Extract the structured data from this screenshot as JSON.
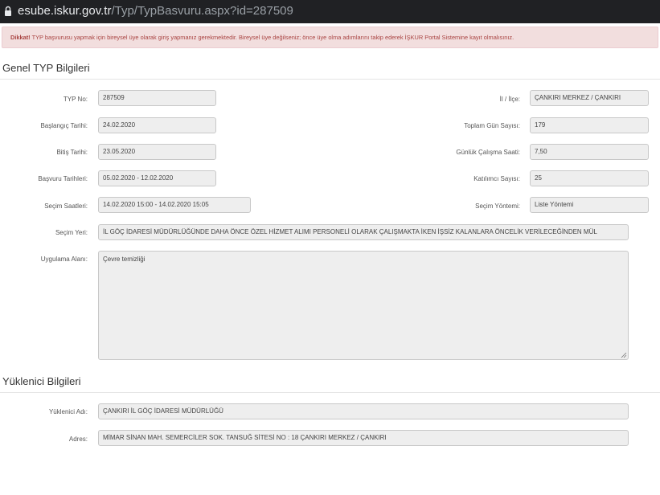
{
  "browser": {
    "url_host": "esube.iskur.gov.tr",
    "url_path": "/Typ/TypBasvuru.aspx?id=287509"
  },
  "alert": {
    "prefix": "Dikkat!",
    "text": " TYP başvurusu yapmak için bireysel üye olarak giriş yapmanız gerekmektedir. Bireysel üye değilseniz; önce üye olma adımlarını takip ederek İŞKUR Portal Sistemine kayıt olmalısınız."
  },
  "genel": {
    "title": "Genel TYP Bilgileri",
    "typ_no_label": "TYP No:",
    "typ_no": "287509",
    "il_ilce_label": "İl / İlçe:",
    "il_ilce": "ÇANKIRI MERKEZ / ÇANKIRI",
    "baslangic_label": "Başlangıç Tarihi:",
    "baslangic": "24.02.2020",
    "toplam_gun_label": "Toplam Gün Sayısı:",
    "toplam_gun": "179",
    "bitis_label": "Bitiş Tarihi:",
    "bitis": "23.05.2020",
    "gunluk_saat_label": "Günlük Çalışma Saati:",
    "gunluk_saat": "7,50",
    "basvuru_label": "Başvuru Tarihleri:",
    "basvuru": "05.02.2020 - 12.02.2020",
    "katilimci_label": "Katılımcı Sayısı:",
    "katilimci": "25",
    "secim_saat_label": "Seçim Saatleri:",
    "secim_saat": "14.02.2020 15:00 - 14.02.2020 15:05",
    "secim_yontem_label": "Seçim Yöntemi:",
    "secim_yontem": "Liste Yöntemi",
    "secim_yeri_label": "Seçim Yeri:",
    "secim_yeri": "İL GÖÇ İDARESİ MÜDÜRLÜĞÜNDE DAHA ÖNCE ÖZEL HİZMET ALIMI PERSONELİ OLARAK ÇALIŞMAKTA İKEN İŞSİZ KALANLARA ÖNCELİK VERİLECEĞİNDEN MÜL",
    "uygulama_label": "Uygulama Alanı:",
    "uygulama": "Çevre temizliği"
  },
  "yuklenici": {
    "title": "Yüklenici Bilgileri",
    "adi_label": "Yüklenici Adı:",
    "adi": "ÇANKIRI İL GÖÇ İDARESİ MÜDÜRLÜĞÜ",
    "adres_label": "Adres:",
    "adres": "MİMAR SİNAN MAH. SEMERCİLER SOK. TANSUĞ SİTESİ NO : 18 ÇANKIRI MERKEZ / ÇANKIRI"
  }
}
